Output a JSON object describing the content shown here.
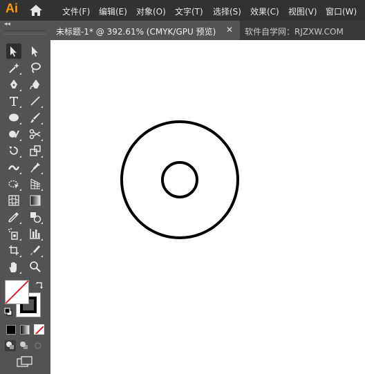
{
  "app": {
    "logo": "Ai"
  },
  "menu": [
    "文件(F)",
    "编辑(E)",
    "对象(O)",
    "文字(T)",
    "选择(S)",
    "效果(C)",
    "视图(V)",
    "窗口(W)"
  ],
  "document": {
    "tab_title": "未标题-1* @ 392.61% (CMYK/GPU 预览)",
    "close_glyph": "✕"
  },
  "watermark": "软件自学网：RJZXW.COM",
  "toolbar": {
    "collapse_glyph": "◂◂"
  },
  "colors": {
    "menubar_bg": "#323232",
    "panel_bg": "#535353",
    "canvas_bg": "#ffffff",
    "logo_color": "#ff9a00",
    "none_slash": "#e02020"
  },
  "tools": [
    "selection-tool",
    "direct-selection-tool",
    "magic-wand-tool",
    "lasso-tool",
    "pen-tool",
    "curvature-tool",
    "type-tool",
    "line-segment-tool",
    "ellipse-tool",
    "paintbrush-tool",
    "shaper-tool",
    "scissors-tool",
    "rotate-tool",
    "scale-tool",
    "width-tool",
    "puppet-warp-tool",
    "free-transform-tool",
    "perspective-grid-tool",
    "mesh-tool",
    "gradient-tool",
    "eyedropper-tool",
    "blend-tool",
    "symbol-sprayer-tool",
    "column-graph-tool",
    "artboard-tool",
    "slice-tool",
    "hand-tool",
    "zoom-tool"
  ]
}
